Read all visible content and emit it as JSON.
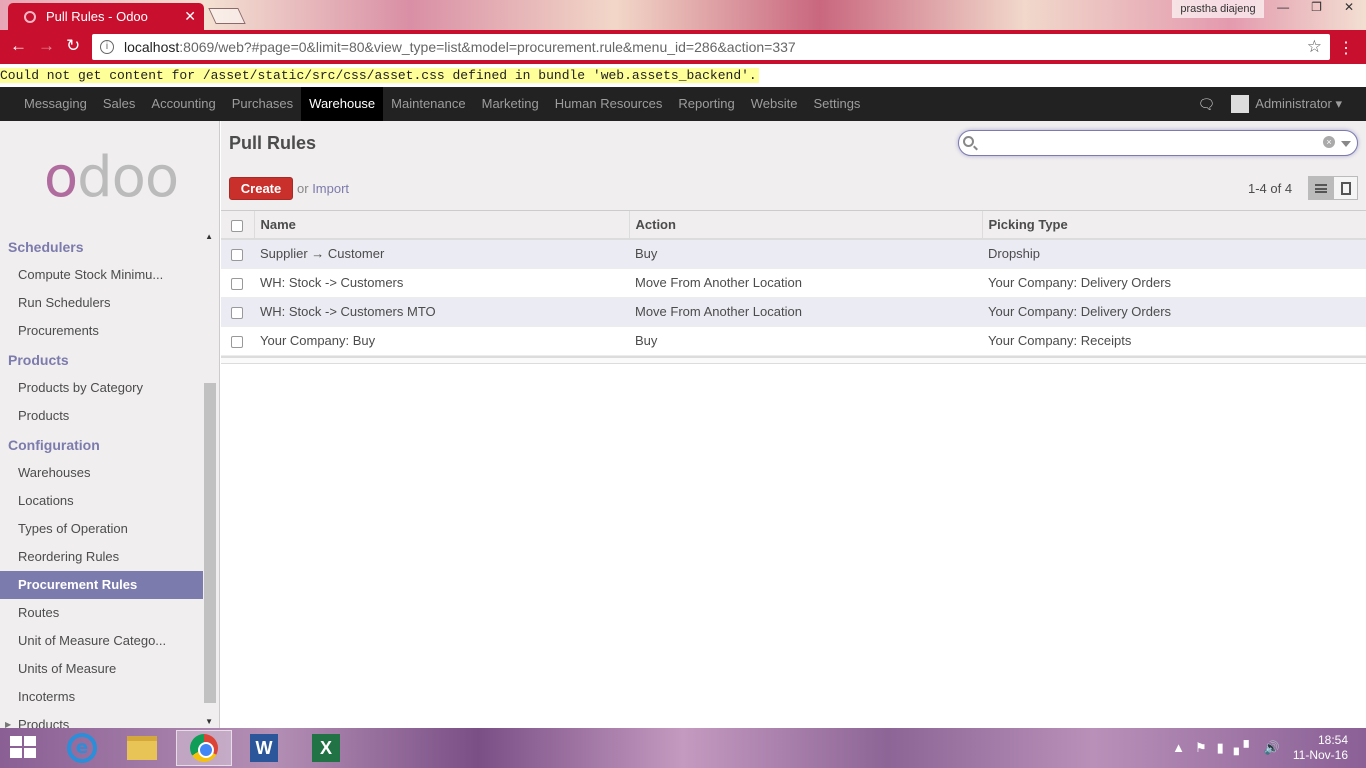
{
  "browser": {
    "tab_title": "Pull Rules - Odoo",
    "tab_close": "✕",
    "user_chip": "prastha diajeng",
    "window_buttons": [
      "—",
      "❐",
      "✕"
    ],
    "url_host": "localhost",
    "url_rest": ":8069/web?#page=0&limit=80&view_type=list&model=procurement.rule&menu_id=286&action=337",
    "back": "←",
    "forward": "→",
    "reload": "↻",
    "star": "☆",
    "menu": "⋮"
  },
  "error_message": "Could not get content for /asset/static/src/css/asset.css defined in bundle 'web.assets_backend'.",
  "topmenu": {
    "items": [
      "Messaging",
      "Sales",
      "Accounting",
      "Purchases",
      "Warehouse",
      "Maintenance",
      "Marketing",
      "Human Resources",
      "Reporting",
      "Website",
      "Settings"
    ],
    "active": "Warehouse",
    "user": "Administrator ▾"
  },
  "sidebar": {
    "logo": "odoo",
    "sections": [
      {
        "title": "Schedulers",
        "items": [
          "Compute Stock Minimu...",
          "Run Schedulers",
          "Procurements"
        ]
      },
      {
        "title": "Products",
        "items": [
          "Products by Category",
          "Products"
        ]
      },
      {
        "title": "Configuration",
        "items": [
          "Warehouses",
          "Locations",
          "Types of Operation",
          "Reordering Rules",
          "Procurement Rules",
          "Routes",
          "Unit of Measure Catego...",
          "Units of Measure",
          "Incoterms",
          "Products"
        ]
      }
    ],
    "active_item": "Procurement Rules"
  },
  "main": {
    "title": "Pull Rules",
    "search_value": "",
    "create_label": "Create",
    "or_label": "or",
    "import_label": "Import",
    "pager": "1-4 of 4",
    "columns": [
      "Name",
      "Action",
      "Picking Type"
    ],
    "rows": [
      {
        "name": "Supplier → Customer",
        "action": "Buy",
        "picking_type": "Dropship"
      },
      {
        "name": "WH: Stock -> Customers",
        "action": "Move From Another Location",
        "picking_type": "Your Company: Delivery Orders"
      },
      {
        "name": "WH: Stock -> Customers MTO",
        "action": "Move From Another Location",
        "picking_type": "Your Company: Delivery Orders"
      },
      {
        "name": "Your Company: Buy",
        "action": "Buy",
        "picking_type": "Your Company: Receipts"
      }
    ]
  },
  "taskbar": {
    "ie_letter": "e",
    "word_letter": "W",
    "excel_letter": "X",
    "time": "18:54",
    "date": "11-Nov-16"
  },
  "colors": {
    "chrome_red": "#c8102e",
    "odoo_purple": "#7c7bad",
    "create_red": "#c9302c"
  }
}
